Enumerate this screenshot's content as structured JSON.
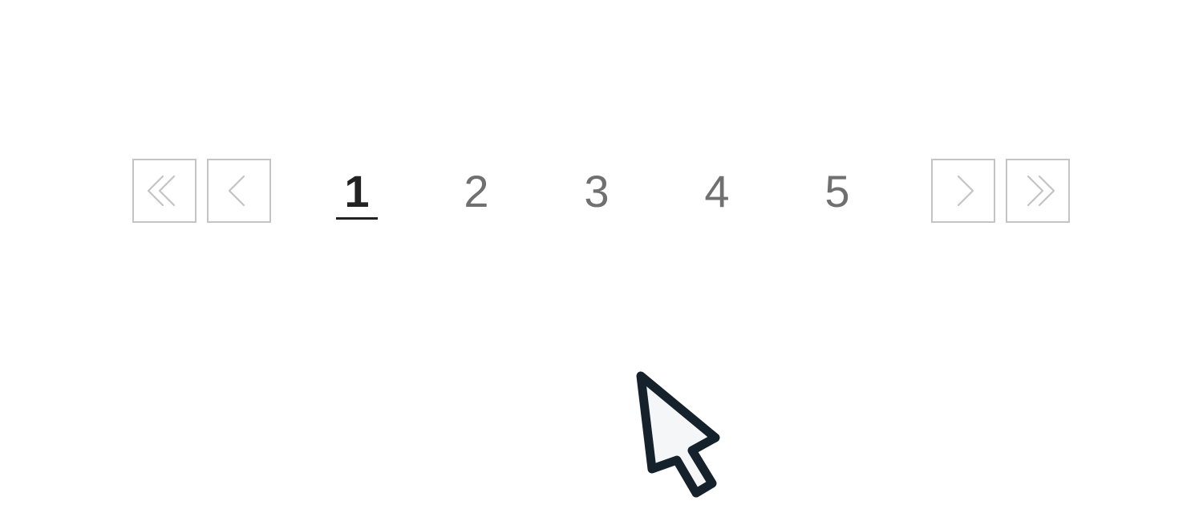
{
  "pagination": {
    "first_button": {
      "icon": "double-chevron-left-icon"
    },
    "prev_button": {
      "icon": "chevron-left-icon"
    },
    "next_button": {
      "icon": "chevron-right-icon"
    },
    "last_button": {
      "icon": "double-chevron-right-icon"
    },
    "pages": [
      {
        "label": "1",
        "active": true
      },
      {
        "label": "2",
        "active": false
      },
      {
        "label": "3",
        "active": false
      },
      {
        "label": "4",
        "active": false
      },
      {
        "label": "5",
        "active": false
      }
    ],
    "current_page": 1
  },
  "colors": {
    "border": "#c4c4c4",
    "page_text": "#707070",
    "active_text": "#222222",
    "cursor_outline": "#15222b",
    "cursor_fill": "#f4f6f7",
    "background": "#ffffff"
  },
  "cursor": {
    "icon": "mouse-pointer-icon"
  }
}
